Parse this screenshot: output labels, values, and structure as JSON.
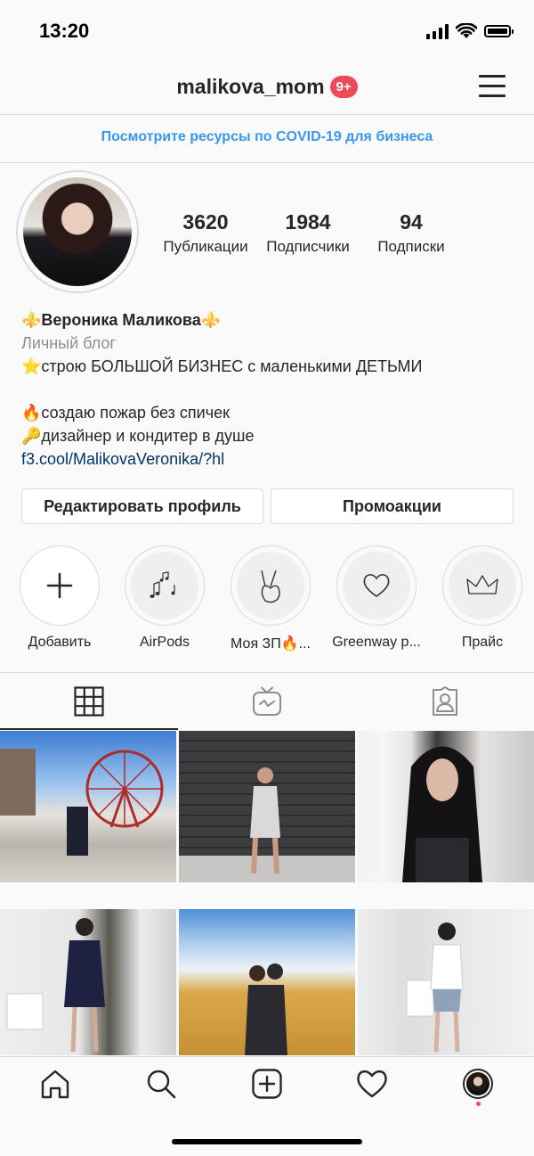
{
  "status_bar": {
    "time": "13:20"
  },
  "header": {
    "username": "malikova_mom",
    "notification_badge": "9+"
  },
  "covid_banner": {
    "text": "Посмотрите ресурсы по COVID-19 для бизнеса"
  },
  "stats": [
    {
      "value": "3620",
      "label": "Публикации"
    },
    {
      "value": "1984",
      "label": "Подписчики"
    },
    {
      "value": "94",
      "label": "Подписки"
    }
  ],
  "bio": {
    "name": "⚜️Вероника Маликова⚜️",
    "category": "Личный блог",
    "line1": "⭐️строю БОЛЬШОЙ БИЗНЕС с маленькими ДЕТЬМИ",
    "line2": "🔥создаю пожар без спичек",
    "line3": "🔑дизайнер и кондитер в душе",
    "link": "f3.cool/MalikovaVeronika/?hl"
  },
  "buttons": {
    "edit_profile": "Редактировать профиль",
    "promotions": "Промоакции"
  },
  "highlights": [
    {
      "label": "Добавить",
      "icon": "plus-icon"
    },
    {
      "label": "AirPods",
      "icon": "music-notes-icon"
    },
    {
      "label": "Моя ЗП🔥...",
      "icon": "peace-hand-icon"
    },
    {
      "label": "Greenway p...",
      "icon": "heart-outline-icon"
    },
    {
      "label": "Прайс",
      "icon": "crown-icon"
    }
  ],
  "tabs": [
    {
      "name": "grid",
      "icon": "grid-icon",
      "active": true
    },
    {
      "name": "igtv",
      "icon": "igtv-icon",
      "active": false
    },
    {
      "name": "tagged",
      "icon": "tagged-user-icon",
      "active": false
    }
  ],
  "bottom_nav": [
    "home-icon",
    "search-icon",
    "new-post-icon",
    "activity-heart-icon",
    "profile-avatar"
  ]
}
